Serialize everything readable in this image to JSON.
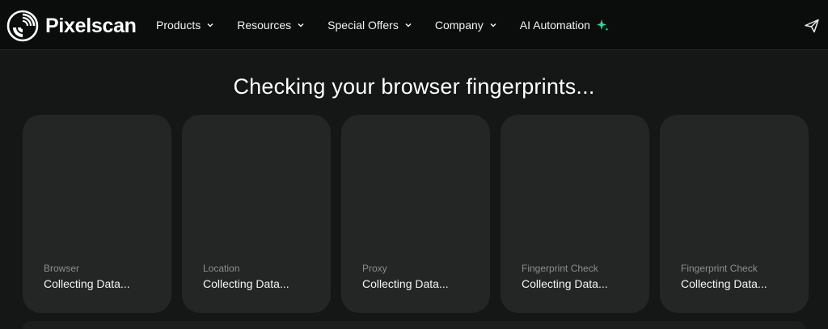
{
  "brand": {
    "name": "Pixelscan"
  },
  "nav": {
    "items": [
      {
        "label": "Products"
      },
      {
        "label": "Resources"
      },
      {
        "label": "Special Offers"
      },
      {
        "label": "Company"
      }
    ],
    "ai_label": "AI Automation",
    "send_icon": "send-icon"
  },
  "colors": {
    "background": "#151716",
    "navbar": "#0b0c0c",
    "card": "#232625",
    "sparkle": "#2dd4a0"
  },
  "main": {
    "heading": "Checking your browser fingerprints...",
    "cards": [
      {
        "label": "Browser",
        "value": "Collecting Data..."
      },
      {
        "label": "Location",
        "value": "Collecting Data..."
      },
      {
        "label": "Proxy",
        "value": "Collecting Data..."
      },
      {
        "label": "Fingerprint Check",
        "value": "Collecting Data..."
      },
      {
        "label": "Fingerprint Check",
        "value": "Collecting Data..."
      }
    ]
  }
}
